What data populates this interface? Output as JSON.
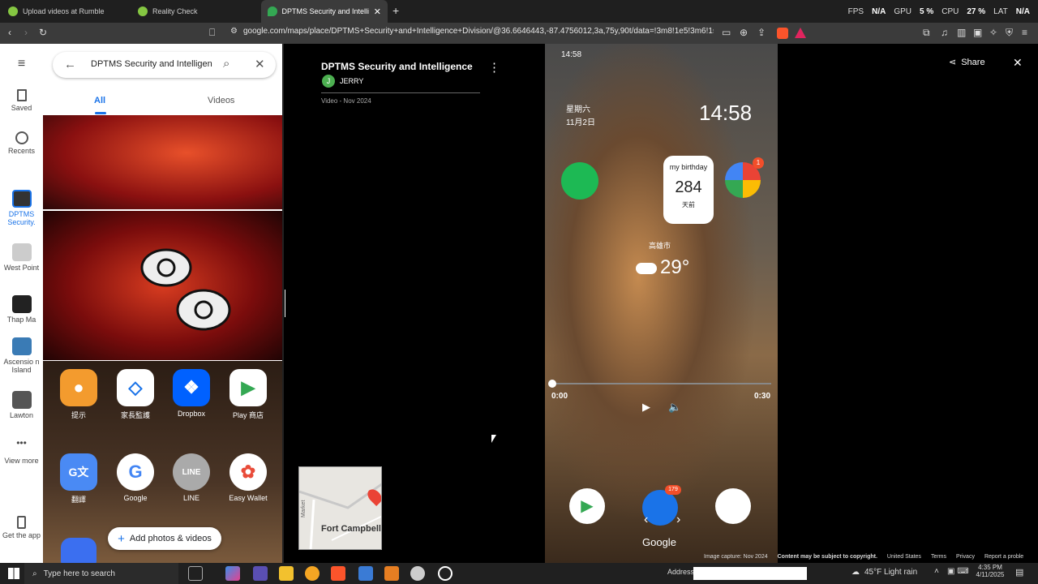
{
  "tabs": [
    {
      "label": "Upload videos at Rumble",
      "color": "#85c742"
    },
    {
      "label": "Reality Check",
      "color": "#85c742"
    },
    {
      "label": "DPTMS Security and Intelligence",
      "color": "#34a853"
    }
  ],
  "perf": {
    "fps_label": "FPS",
    "fps": "N/A",
    "gpu_label": "GPU",
    "gpu": "5 %",
    "cpu_label": "CPU",
    "cpu": "27 %",
    "lat_label": "LAT",
    "lat": "N/A"
  },
  "address": {
    "url": "google.com/maps/place/DPTMS+Security+and+Intelligence+Division/@36.6646443,-87.4756012,3a,75y,90t/data=!3m8!1e5!3m6!1sCIHM..."
  },
  "rail": {
    "saved": "Saved",
    "recents": "Recents",
    "dptms": "DPTMS Security.",
    "west_point": "West Point",
    "thap_ma": "Thap Ma",
    "ascension": "Ascensio n Island",
    "lawton": "Lawton",
    "view_more": "View more",
    "get_app": "Get the app"
  },
  "panel": {
    "search_value": "DPTMS Security and Intelligen",
    "tab_all": "All",
    "tab_videos": "Videos",
    "add_photos": "Add photos & videos",
    "apps": [
      {
        "label": "提示",
        "color": "#f39b2e",
        "glyph": "●"
      },
      {
        "label": "家長監護",
        "color": "#ffffff",
        "glyph": "◇"
      },
      {
        "label": "Dropbox",
        "color": "#0061ff",
        "glyph": "❖"
      },
      {
        "label": "Play 商店",
        "color": "#ffffff",
        "glyph": "▶"
      },
      {
        "label": "翻譯",
        "color": "#4a8af4",
        "glyph": "G文"
      },
      {
        "label": "Google",
        "color": "#ffffff",
        "glyph": "G"
      },
      {
        "label": "LINE",
        "color": "#aaaaaa",
        "glyph": "LINE"
      },
      {
        "label": "Easy Wallet",
        "color": "#ffffff",
        "glyph": "✿"
      }
    ]
  },
  "viewer": {
    "title": "DPTMS Security and Intelligence Di...",
    "author_initial": "J",
    "author": "JERRY",
    "meta": "Video - Nov 2024",
    "share": "Share",
    "time_start": "0:00",
    "time_end": "0:30",
    "map_label": "Fort Campbell",
    "map_street": "Market",
    "phone": {
      "status_time": "14:58",
      "weekday": "星期六",
      "date": "11月2日",
      "clock": "14:58",
      "bday_title": "my birthday",
      "bday_num": "284",
      "bday_unit": "天前",
      "city": "高雄市",
      "temp": "29°",
      "google": "Google",
      "badge1": "1",
      "badge2": "179"
    },
    "footer": [
      "Image capture: Nov 2024",
      "Content may be subject to copyright.",
      "United States",
      "Terms",
      "Privacy",
      "Report a proble"
    ]
  },
  "taskbar": {
    "search": "Type here to search",
    "address_label": "Address",
    "weather": "45°F Light rain",
    "time": "4:35 PM",
    "date": "4/11/2025"
  }
}
